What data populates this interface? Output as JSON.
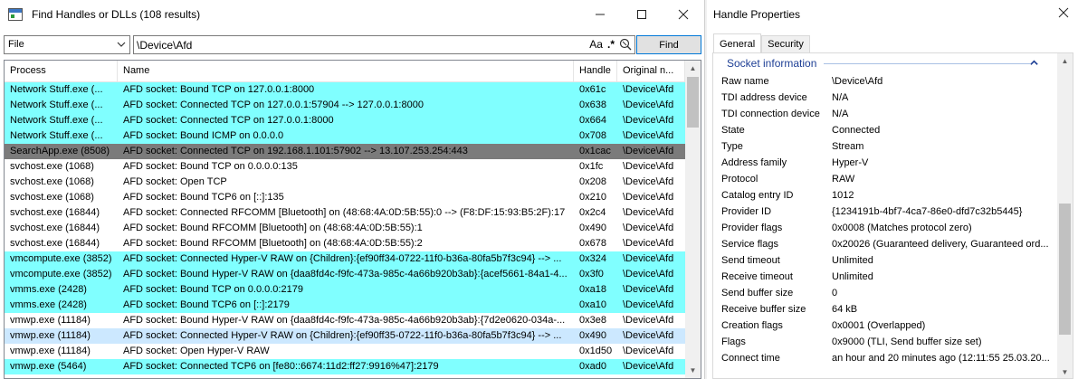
{
  "left_window": {
    "title": "Find Handles or DLLs (108 results)",
    "minimize_glyph": "—",
    "maximize_glyph": "☐",
    "close_glyph": "✕",
    "filter_type": "File",
    "query": "\\Device\\Afd",
    "case_toggle": "Aa",
    "regex_toggle": ".*",
    "find_label": "Find",
    "columns": [
      "Process",
      "Name",
      "Handle",
      "Original n..."
    ],
    "rows": [
      {
        "style": "cyan",
        "process": "Network Stuff.exe (...",
        "name": "AFD socket: Bound TCP on 127.0.0.1:8000",
        "handle": "0x61c",
        "orig": "\\Device\\Afd"
      },
      {
        "style": "cyan",
        "process": "Network Stuff.exe (...",
        "name": "AFD socket: Connected TCP on 127.0.0.1:57904 --> 127.0.0.1:8000",
        "handle": "0x638",
        "orig": "\\Device\\Afd"
      },
      {
        "style": "cyan",
        "process": "Network Stuff.exe (...",
        "name": "AFD socket: Connected TCP on 127.0.0.1:8000",
        "handle": "0x664",
        "orig": "\\Device\\Afd"
      },
      {
        "style": "cyan",
        "process": "Network Stuff.exe (...",
        "name": "AFD socket: Bound ICMP on 0.0.0.0",
        "handle": "0x708",
        "orig": "\\Device\\Afd"
      },
      {
        "style": "dark",
        "process": "SearchApp.exe (8508)",
        "name": "AFD socket: Connected TCP on 192.168.1.101:57902 --> 13.107.253.254:443",
        "handle": "0x1cac",
        "orig": "\\Device\\Afd"
      },
      {
        "style": "plain",
        "process": "svchost.exe (1068)",
        "name": "AFD socket: Bound TCP on 0.0.0.0:135",
        "handle": "0x1fc",
        "orig": "\\Device\\Afd"
      },
      {
        "style": "plain",
        "process": "svchost.exe (1068)",
        "name": "AFD socket: Open TCP",
        "handle": "0x208",
        "orig": "\\Device\\Afd"
      },
      {
        "style": "plain",
        "process": "svchost.exe (1068)",
        "name": "AFD socket: Bound TCP6 on [::]:135",
        "handle": "0x210",
        "orig": "\\Device\\Afd"
      },
      {
        "style": "plain",
        "process": "svchost.exe (16844)",
        "name": "AFD socket: Connected RFCOMM [Bluetooth] on (48:68:4A:0D:5B:55):0 --> (F8:DF:15:93:B5:2F):17",
        "handle": "0x2c4",
        "orig": "\\Device\\Afd"
      },
      {
        "style": "plain",
        "process": "svchost.exe (16844)",
        "name": "AFD socket: Bound RFCOMM [Bluetooth] on (48:68:4A:0D:5B:55):1",
        "handle": "0x490",
        "orig": "\\Device\\Afd"
      },
      {
        "style": "plain",
        "process": "svchost.exe (16844)",
        "name": "AFD socket: Bound RFCOMM [Bluetooth] on (48:68:4A:0D:5B:55):2",
        "handle": "0x678",
        "orig": "\\Device\\Afd"
      },
      {
        "style": "cyan",
        "process": "vmcompute.exe (3852)",
        "name": "AFD socket: Connected Hyper-V RAW on {Children}:{ef90ff34-0722-11f0-b36a-80fa5b7f3c94} --> ...",
        "handle": "0x324",
        "orig": "\\Device\\Afd"
      },
      {
        "style": "cyan",
        "process": "vmcompute.exe (3852)",
        "name": "AFD socket: Bound Hyper-V RAW on {daa8fd4c-f9fc-473a-985c-4a66b920b3ab}:{acef5661-84a1-4...",
        "handle": "0x3f0",
        "orig": "\\Device\\Afd"
      },
      {
        "style": "cyan",
        "process": "vmms.exe (2428)",
        "name": "AFD socket: Bound TCP on 0.0.0.0:2179",
        "handle": "0xa18",
        "orig": "\\Device\\Afd"
      },
      {
        "style": "cyan",
        "process": "vmms.exe (2428)",
        "name": "AFD socket: Bound TCP6 on [::]:2179",
        "handle": "0xa10",
        "orig": "\\Device\\Afd"
      },
      {
        "style": "plain",
        "process": "vmwp.exe (11184)",
        "name": "AFD socket: Bound Hyper-V RAW on {daa8fd4c-f9fc-473a-985c-4a66b920b3ab}:{7d2e0620-034a-...",
        "handle": "0x3e8",
        "orig": "\\Device\\Afd"
      },
      {
        "style": "sel",
        "process": "vmwp.exe (11184)",
        "name": "AFD socket: Connected Hyper-V RAW on {Children}:{ef90ff35-0722-11f0-b36a-80fa5b7f3c94} --> ...",
        "handle": "0x490",
        "orig": "\\Device\\Afd"
      },
      {
        "style": "plain",
        "process": "vmwp.exe (11184)",
        "name": "AFD socket: Open Hyper-V RAW",
        "handle": "0x1d50",
        "orig": "\\Device\\Afd"
      },
      {
        "style": "cyan",
        "process": "vmwp.exe (5464)",
        "name": "AFD socket: Connected TCP6 on [fe80::6674:11d2:ff27:9916%47]:2179",
        "handle": "0xad0",
        "orig": "\\Device\\Afd"
      }
    ]
  },
  "right_window": {
    "title": "Handle Properties",
    "close_glyph": "✕",
    "tabs": [
      "General",
      "Security"
    ],
    "group_title": "Socket information",
    "properties": [
      {
        "label": "Raw name",
        "value": "\\Device\\Afd"
      },
      {
        "label": "TDI address device",
        "value": "N/A"
      },
      {
        "label": "TDI connection device",
        "value": "N/A"
      },
      {
        "label": "State",
        "value": "Connected"
      },
      {
        "label": "Type",
        "value": "Stream"
      },
      {
        "label": "Address family",
        "value": "Hyper-V"
      },
      {
        "label": "Protocol",
        "value": "RAW"
      },
      {
        "label": "Catalog entry ID",
        "value": "1012"
      },
      {
        "label": "Provider ID",
        "value": "{1234191b-4bf7-4ca7-86e0-dfd7c32b5445}"
      },
      {
        "label": "Provider flags",
        "value": "0x0008 (Matches protocol zero)"
      },
      {
        "label": "Service flags",
        "value": "0x20026 (Guaranteed delivery, Guaranteed ord..."
      },
      {
        "label": "Send timeout",
        "value": "Unlimited"
      },
      {
        "label": "Receive timeout",
        "value": "Unlimited"
      },
      {
        "label": "Send buffer size",
        "value": "0"
      },
      {
        "label": "Receive buffer size",
        "value": "64 kB"
      },
      {
        "label": "Creation flags",
        "value": "0x0001 (Overlapped)"
      },
      {
        "label": "Flags",
        "value": "0x9000 (TLI, Send buffer size set)"
      },
      {
        "label": "Connect time",
        "value": "an hour and 20 minutes ago (12:11:55 25.03.20..."
      }
    ]
  },
  "colors": {
    "highlight_cyan": "#80ffff",
    "highlight_gray": "#7b7b7b",
    "selected": "#cce8ff",
    "accent_blue": "#0078d7"
  }
}
